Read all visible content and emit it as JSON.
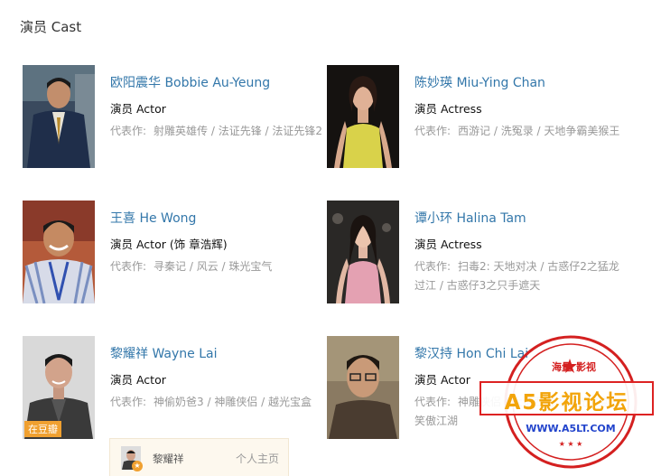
{
  "section": {
    "title": "演员 Cast"
  },
  "cast": [
    {
      "name": "欧阳震华 Bobbie Au-Yeung",
      "role": "演员 Actor",
      "works_label": "代表作:",
      "works": "射雕英雄传 / 法证先锋 / 法证先锋2"
    },
    {
      "name": "陈妙瑛 Miu-Ying Chan",
      "role": "演员 Actress",
      "works_label": "代表作:",
      "works": "西游记 / 洗冤录 / 天地争霸美猴王"
    },
    {
      "name": "王喜 He Wong",
      "role": "演员 Actor (饰 章浩辉)",
      "works_label": "代表作:",
      "works": "寻秦记 / 风云 / 珠光宝气"
    },
    {
      "name": "谭小环 Halina Tam",
      "role": "演员 Actress",
      "works_label": "代表作:",
      "works": "扫毒2: 天地对决 / 古惑仔2之猛龙过江 / 古惑仔3之只手遮天"
    },
    {
      "name": "黎耀祥 Wayne Lai",
      "role": "演员 Actor",
      "works_label": "代表作:",
      "works": "神偷奶爸3 / 神雕侠侣 / 越光宝盒",
      "badge": "在豆瓣"
    },
    {
      "name": "黎汉持 Hon Chi Lai",
      "role": "演员 Actor",
      "works_label": "代表作:",
      "works": "神雕侠侣 / 大话西游之月光宝盒 / 笑傲江湖"
    }
  ],
  "douban_box": {
    "name": "黎耀祥",
    "home_link": "个人主页"
  },
  "watermark": {
    "top_left": "海量",
    "top_right": "影视",
    "banner": "A5影视论坛",
    "url": "WWW.A5LT.COM"
  }
}
